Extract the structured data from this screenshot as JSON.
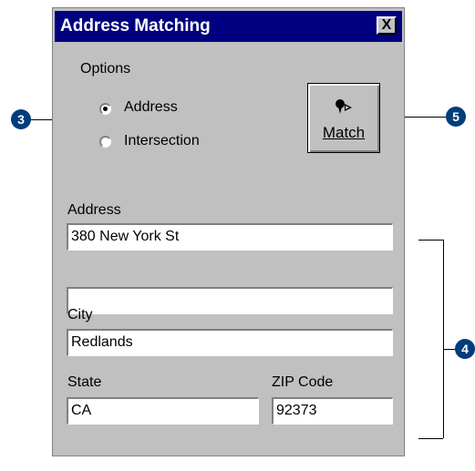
{
  "dialog": {
    "title": "Address Matching",
    "close_label": "X"
  },
  "options": {
    "group_label": "Options",
    "choices": [
      {
        "label": "Address",
        "selected": true
      },
      {
        "label": "Intersection",
        "selected": false
      }
    ]
  },
  "match_button": {
    "label": "Match",
    "icon": "pin-icon"
  },
  "fields": {
    "address_label": "Address",
    "address_line1": "380 New York St",
    "address_line2": "",
    "city_label": "City",
    "city": "Redlands",
    "state_label": "State",
    "state": "CA",
    "zip_label": "ZIP Code",
    "zip": "92373"
  },
  "callouts": {
    "c3": "3",
    "c4": "4",
    "c5": "5"
  },
  "colors": {
    "titlebar": "#000080",
    "dialog_bg": "#c0c0c0",
    "callout": "#003d7a"
  }
}
